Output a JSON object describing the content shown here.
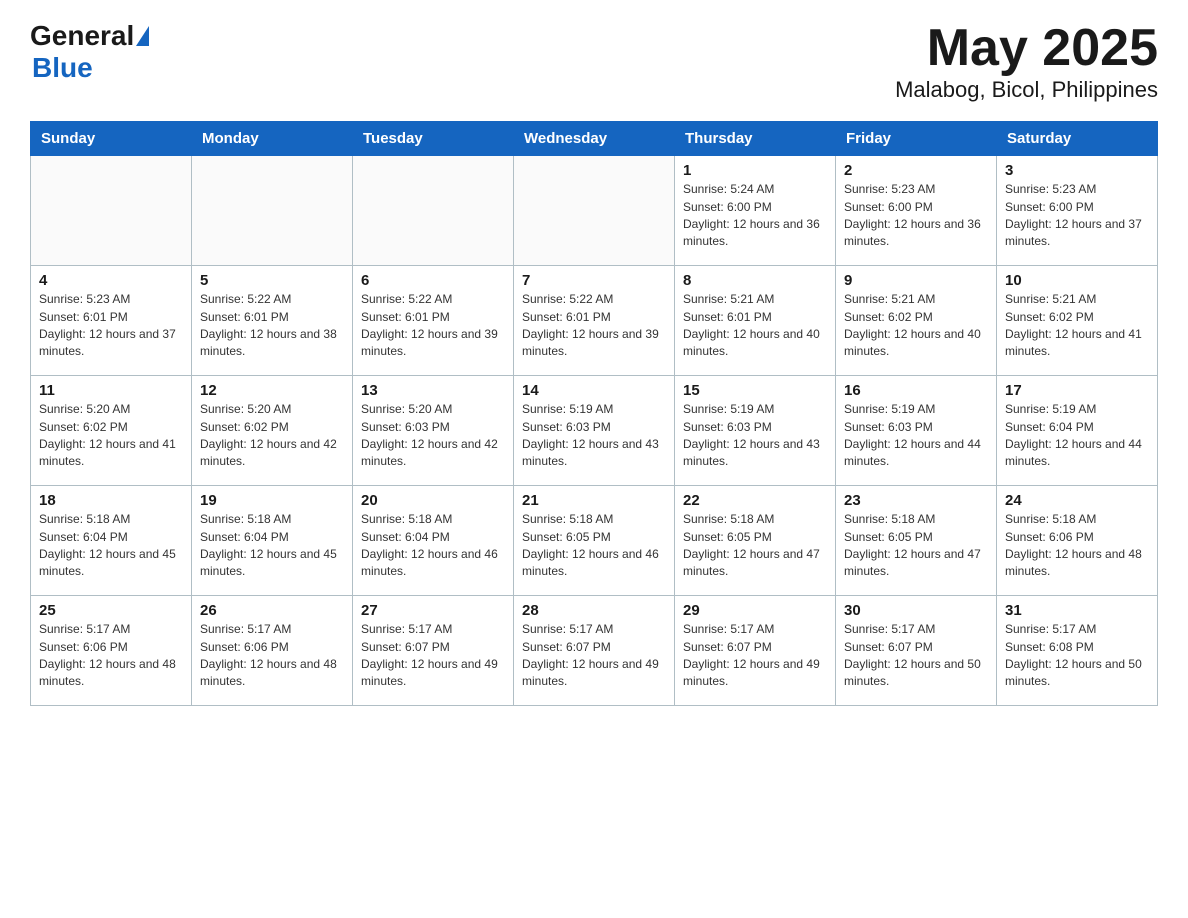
{
  "header": {
    "logo_general": "General",
    "logo_blue": "Blue",
    "title": "May 2025",
    "subtitle": "Malabog, Bicol, Philippines"
  },
  "days_of_week": [
    "Sunday",
    "Monday",
    "Tuesday",
    "Wednesday",
    "Thursday",
    "Friday",
    "Saturday"
  ],
  "weeks": [
    {
      "days": [
        {
          "number": "",
          "info": ""
        },
        {
          "number": "",
          "info": ""
        },
        {
          "number": "",
          "info": ""
        },
        {
          "number": "",
          "info": ""
        },
        {
          "number": "1",
          "info": "Sunrise: 5:24 AM\nSunset: 6:00 PM\nDaylight: 12 hours and 36 minutes."
        },
        {
          "number": "2",
          "info": "Sunrise: 5:23 AM\nSunset: 6:00 PM\nDaylight: 12 hours and 36 minutes."
        },
        {
          "number": "3",
          "info": "Sunrise: 5:23 AM\nSunset: 6:00 PM\nDaylight: 12 hours and 37 minutes."
        }
      ]
    },
    {
      "days": [
        {
          "number": "4",
          "info": "Sunrise: 5:23 AM\nSunset: 6:01 PM\nDaylight: 12 hours and 37 minutes."
        },
        {
          "number": "5",
          "info": "Sunrise: 5:22 AM\nSunset: 6:01 PM\nDaylight: 12 hours and 38 minutes."
        },
        {
          "number": "6",
          "info": "Sunrise: 5:22 AM\nSunset: 6:01 PM\nDaylight: 12 hours and 39 minutes."
        },
        {
          "number": "7",
          "info": "Sunrise: 5:22 AM\nSunset: 6:01 PM\nDaylight: 12 hours and 39 minutes."
        },
        {
          "number": "8",
          "info": "Sunrise: 5:21 AM\nSunset: 6:01 PM\nDaylight: 12 hours and 40 minutes."
        },
        {
          "number": "9",
          "info": "Sunrise: 5:21 AM\nSunset: 6:02 PM\nDaylight: 12 hours and 40 minutes."
        },
        {
          "number": "10",
          "info": "Sunrise: 5:21 AM\nSunset: 6:02 PM\nDaylight: 12 hours and 41 minutes."
        }
      ]
    },
    {
      "days": [
        {
          "number": "11",
          "info": "Sunrise: 5:20 AM\nSunset: 6:02 PM\nDaylight: 12 hours and 41 minutes."
        },
        {
          "number": "12",
          "info": "Sunrise: 5:20 AM\nSunset: 6:02 PM\nDaylight: 12 hours and 42 minutes."
        },
        {
          "number": "13",
          "info": "Sunrise: 5:20 AM\nSunset: 6:03 PM\nDaylight: 12 hours and 42 minutes."
        },
        {
          "number": "14",
          "info": "Sunrise: 5:19 AM\nSunset: 6:03 PM\nDaylight: 12 hours and 43 minutes."
        },
        {
          "number": "15",
          "info": "Sunrise: 5:19 AM\nSunset: 6:03 PM\nDaylight: 12 hours and 43 minutes."
        },
        {
          "number": "16",
          "info": "Sunrise: 5:19 AM\nSunset: 6:03 PM\nDaylight: 12 hours and 44 minutes."
        },
        {
          "number": "17",
          "info": "Sunrise: 5:19 AM\nSunset: 6:04 PM\nDaylight: 12 hours and 44 minutes."
        }
      ]
    },
    {
      "days": [
        {
          "number": "18",
          "info": "Sunrise: 5:18 AM\nSunset: 6:04 PM\nDaylight: 12 hours and 45 minutes."
        },
        {
          "number": "19",
          "info": "Sunrise: 5:18 AM\nSunset: 6:04 PM\nDaylight: 12 hours and 45 minutes."
        },
        {
          "number": "20",
          "info": "Sunrise: 5:18 AM\nSunset: 6:04 PM\nDaylight: 12 hours and 46 minutes."
        },
        {
          "number": "21",
          "info": "Sunrise: 5:18 AM\nSunset: 6:05 PM\nDaylight: 12 hours and 46 minutes."
        },
        {
          "number": "22",
          "info": "Sunrise: 5:18 AM\nSunset: 6:05 PM\nDaylight: 12 hours and 47 minutes."
        },
        {
          "number": "23",
          "info": "Sunrise: 5:18 AM\nSunset: 6:05 PM\nDaylight: 12 hours and 47 minutes."
        },
        {
          "number": "24",
          "info": "Sunrise: 5:18 AM\nSunset: 6:06 PM\nDaylight: 12 hours and 48 minutes."
        }
      ]
    },
    {
      "days": [
        {
          "number": "25",
          "info": "Sunrise: 5:17 AM\nSunset: 6:06 PM\nDaylight: 12 hours and 48 minutes."
        },
        {
          "number": "26",
          "info": "Sunrise: 5:17 AM\nSunset: 6:06 PM\nDaylight: 12 hours and 48 minutes."
        },
        {
          "number": "27",
          "info": "Sunrise: 5:17 AM\nSunset: 6:07 PM\nDaylight: 12 hours and 49 minutes."
        },
        {
          "number": "28",
          "info": "Sunrise: 5:17 AM\nSunset: 6:07 PM\nDaylight: 12 hours and 49 minutes."
        },
        {
          "number": "29",
          "info": "Sunrise: 5:17 AM\nSunset: 6:07 PM\nDaylight: 12 hours and 49 minutes."
        },
        {
          "number": "30",
          "info": "Sunrise: 5:17 AM\nSunset: 6:07 PM\nDaylight: 12 hours and 50 minutes."
        },
        {
          "number": "31",
          "info": "Sunrise: 5:17 AM\nSunset: 6:08 PM\nDaylight: 12 hours and 50 minutes."
        }
      ]
    }
  ]
}
